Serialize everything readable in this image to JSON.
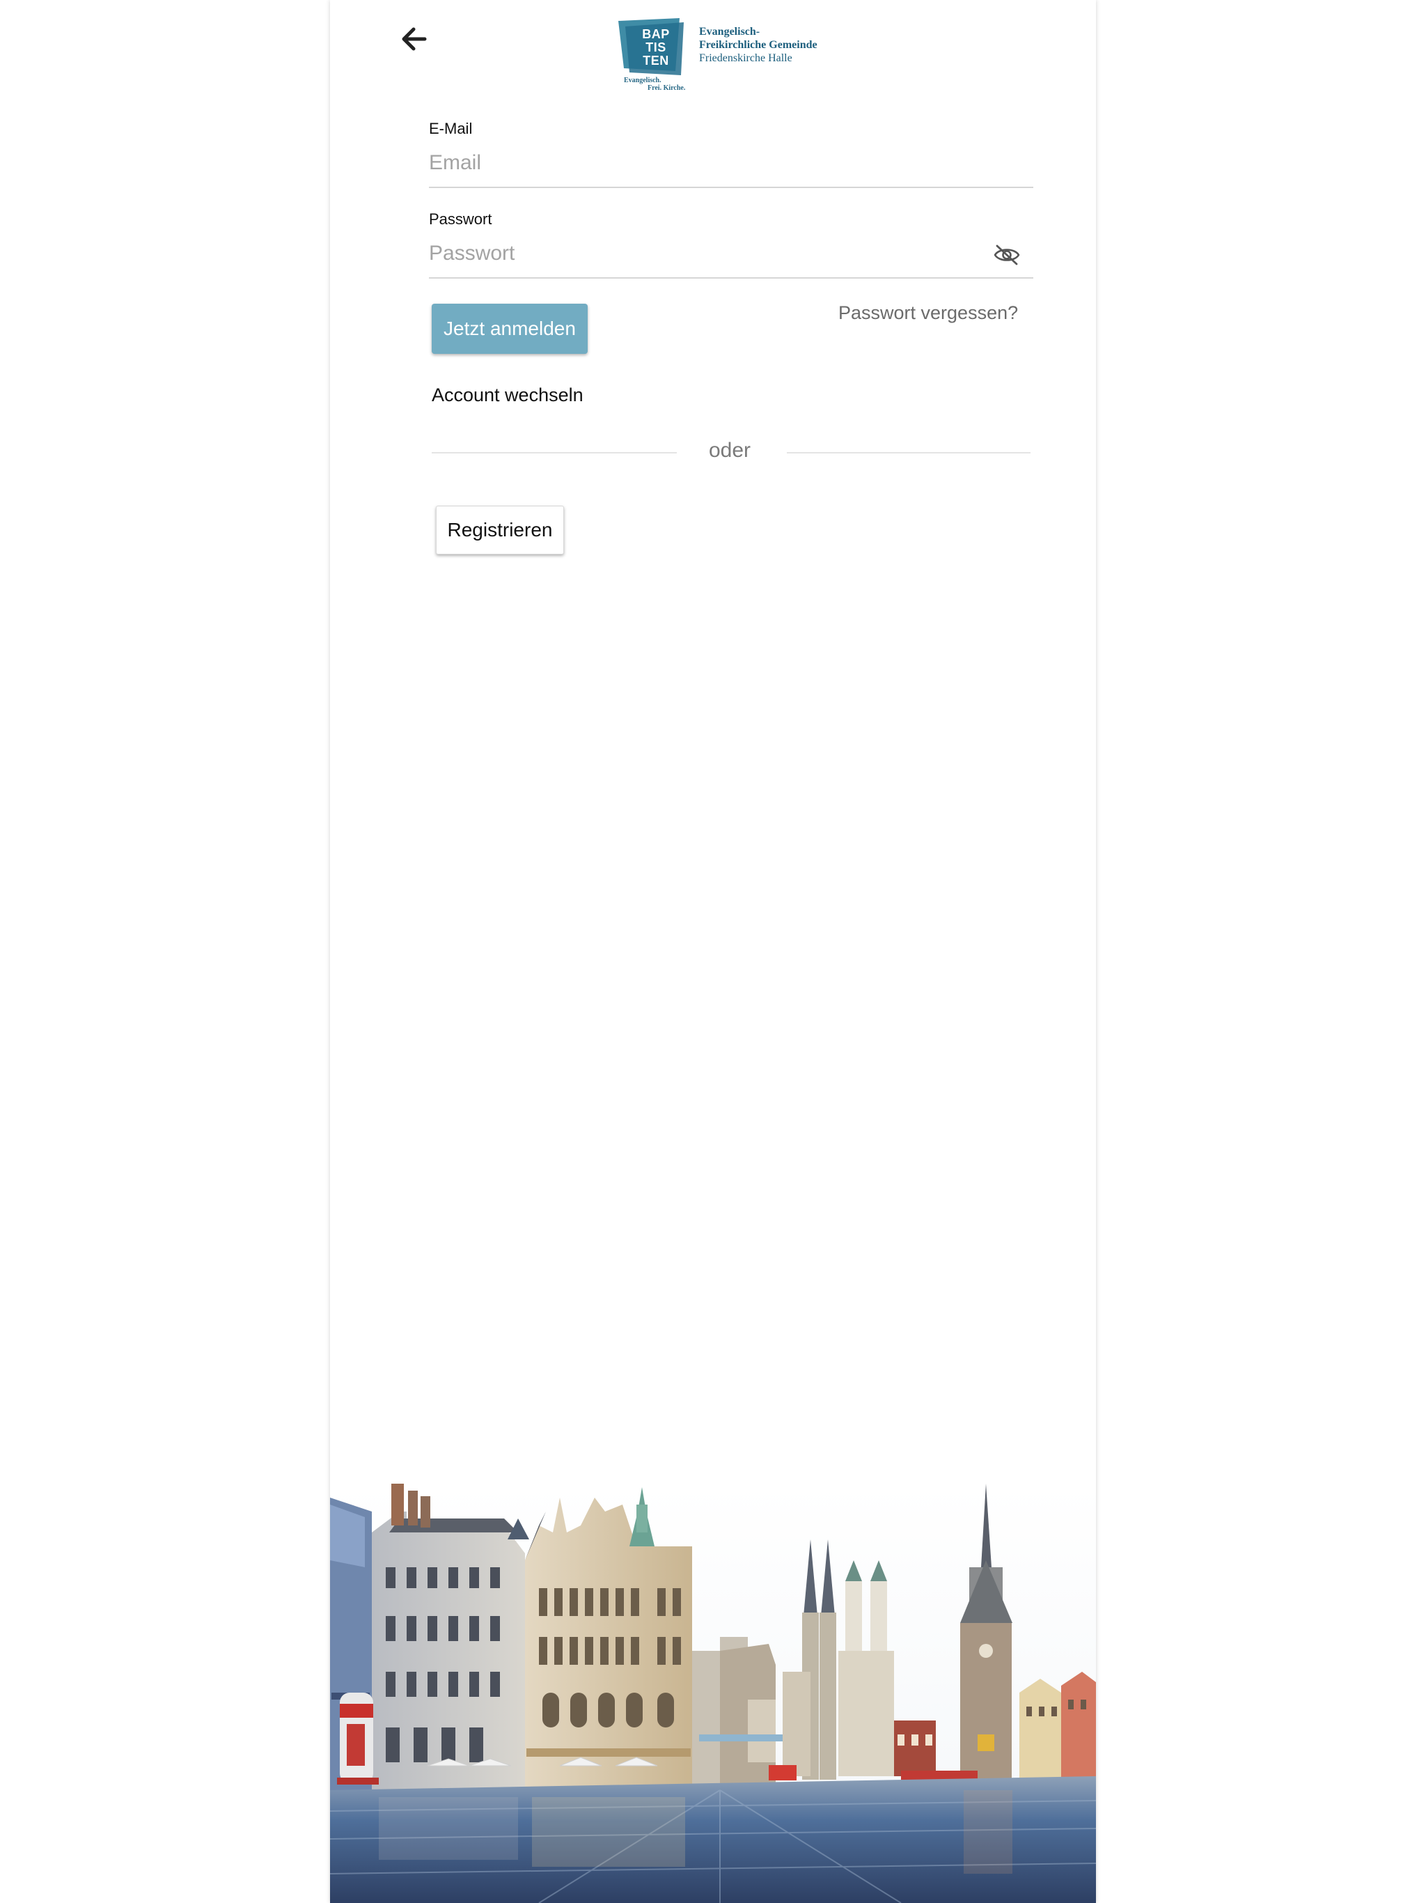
{
  "header": {
    "back_icon": "arrow-left-icon",
    "logo": {
      "mark_lines": [
        "BAP",
        "TIS",
        "TEN"
      ],
      "mark_sub_1": "Evangelisch.",
      "mark_sub_2": "Frei. Kirche.",
      "line1": "Evangelisch-",
      "line2": "Freikirchliche Gemeinde",
      "line3": "Friedenskirche Halle"
    }
  },
  "form": {
    "email": {
      "label": "E-Mail",
      "placeholder": "Email",
      "value": ""
    },
    "password": {
      "label": "Passwort",
      "placeholder": "Passwort",
      "value": "",
      "toggle_icon": "eye-off-icon"
    },
    "login_button": "Jetzt anmelden",
    "forgot_link": "Passwort vergessen?",
    "switch_account": "Account wechseln",
    "divider_text": "oder",
    "register_button": "Registrieren"
  },
  "colors": {
    "primary_button": "#72acc2",
    "logo_teal": "#1d5f7e"
  }
}
